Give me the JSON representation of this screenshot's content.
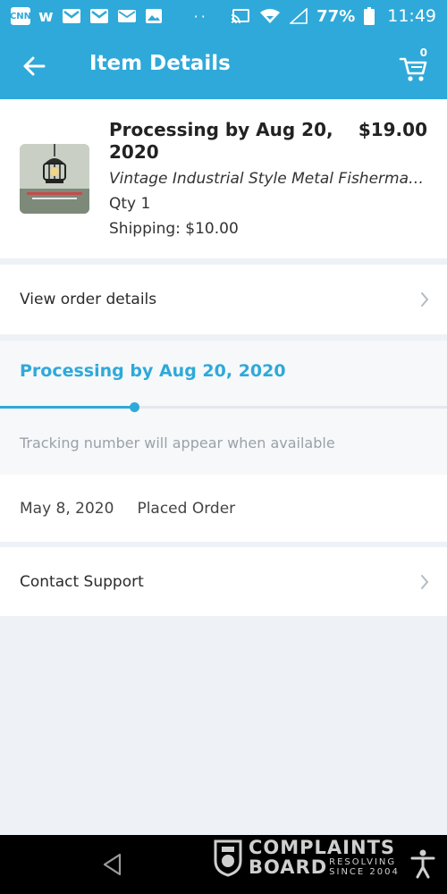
{
  "status_bar": {
    "left_icons": [
      "cnn-icon",
      "wish-icon",
      "gmail-icon",
      "gmail-icon",
      "mail-icon",
      "photo-icon"
    ],
    "cnn_label": "CNN",
    "wish_label": "w",
    "dots": "··",
    "battery_percent": "77%",
    "time": "11:49"
  },
  "header": {
    "title": "Item Details",
    "cart_count": "0"
  },
  "item": {
    "status": "Processing by Aug 20, 2020",
    "price": "$19.00",
    "name": "Vintage Industrial Style Metal Fisherman Lamp",
    "qty": "Qty 1",
    "shipping": "Shipping: $10.00"
  },
  "view_order": {
    "label": "View order details"
  },
  "tracking": {
    "title": "Processing by Aug 20, 2020",
    "progress_fraction": 0.3,
    "note": "Tracking number will appear when available"
  },
  "events": [
    {
      "date": "May 8, 2020",
      "label": "Placed Order"
    }
  ],
  "contact": {
    "label": "Contact Support"
  },
  "watermark": {
    "line1": "COMPLAINTS",
    "line2": "BOARD",
    "sub1": "RESOLVING",
    "sub2": "SINCE 2004"
  },
  "colors": {
    "accent": "#2fa9d9",
    "background": "#eef1f5"
  }
}
